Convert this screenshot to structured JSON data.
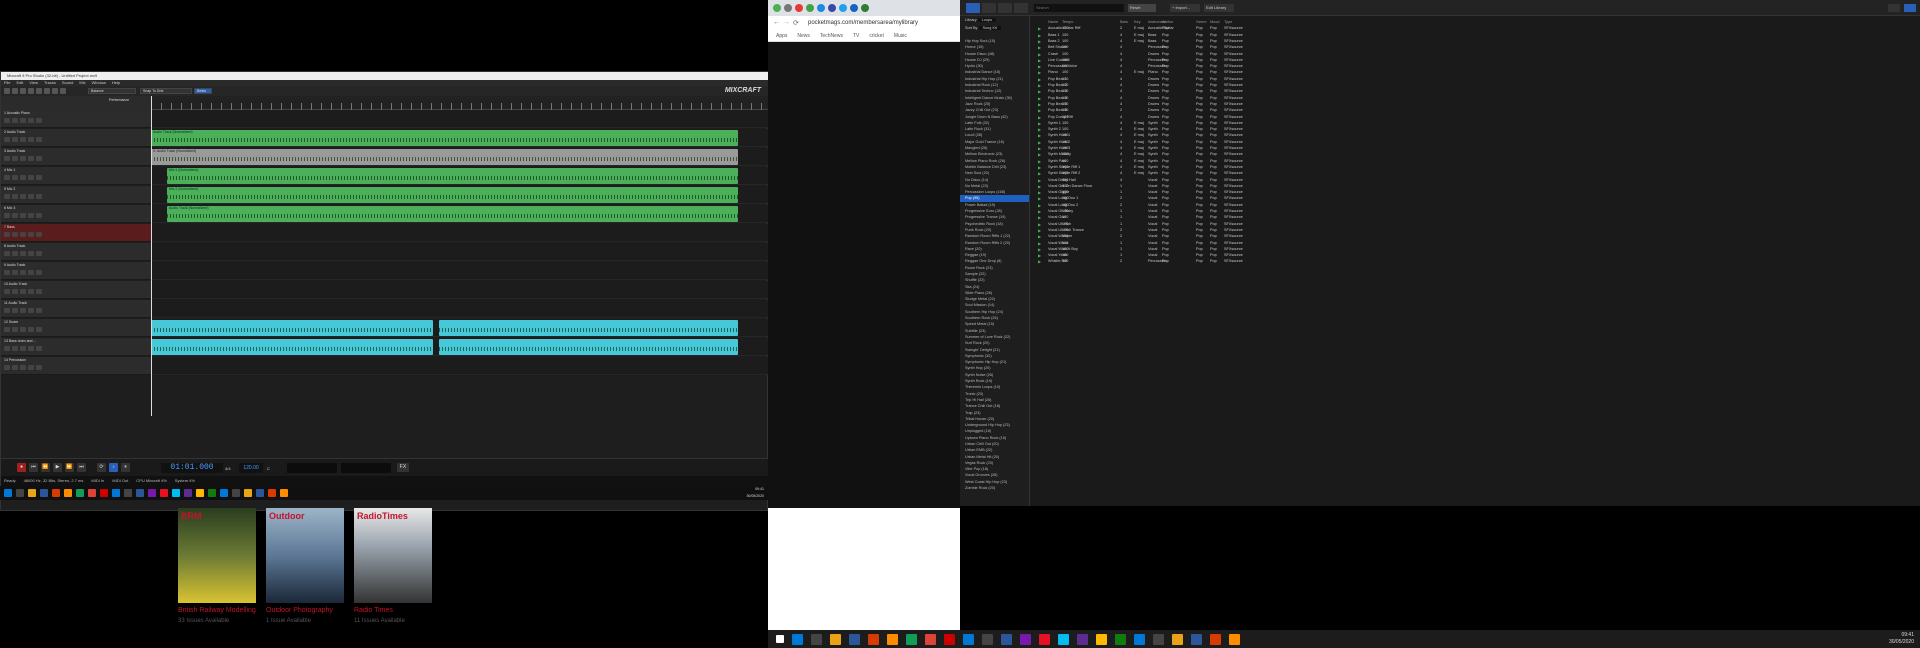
{
  "mixcraft": {
    "title": "Mixcraft 9 Pro Studio (32-bit) - Untitled Project.mx9",
    "menu": [
      "File",
      "Edit",
      "View",
      "Tracks",
      "Sound",
      "Mix",
      "Window",
      "Help"
    ],
    "logo": "MIXCRAFT",
    "toolbar_select_1": "Balance",
    "toolbar_select_2": "Snap To Grid",
    "toolbar_btn": "Beats",
    "header_label": "Performance",
    "tracks": [
      {
        "name": "1 Acoustic Piano"
      },
      {
        "name": "2 Audio Track"
      },
      {
        "name": "3 Audio Track"
      },
      {
        "name": "4 Mic 1"
      },
      {
        "name": "5 Mic 2"
      },
      {
        "name": "6 Mic 3"
      },
      {
        "name": "7 Bass"
      },
      {
        "name": "8 Audio Track"
      },
      {
        "name": "9 Audio Track"
      },
      {
        "name": "10 Audio Track"
      },
      {
        "name": "11 Audio Track"
      },
      {
        "name": "12 Snare"
      },
      {
        "name": "13 Bass drum and ..."
      },
      {
        "name": "14 Percussion"
      }
    ],
    "clips": {
      "c1": "Audio Track (Normalized)",
      "c2": "3: Audio Track (Normalized)",
      "c3": "Mic 1 (Normalized)",
      "c4": "Mic 2 (Normalized)",
      "c5": "Audio Track (Normalized)"
    },
    "transport_time": "01:01.000",
    "time_sig": "4/4",
    "bpm": "120.00",
    "key": "C",
    "fx": "FX",
    "status": [
      "Ready",
      "48000 Hz, 32 Bits, Stereo, 2.7 ms",
      "MIDI In",
      "MIDI Out",
      "CPU Mixcraft 4%",
      "System 4%"
    ],
    "clock_time": "09:41",
    "clock_date": "30/05/2020"
  },
  "browser": {
    "url": "pocketmags.com/membersarea/mylibrary",
    "bookmarks": [
      "Apps",
      "News",
      "TechNews",
      "TV",
      "cricket",
      "Music"
    ],
    "magazines": [
      {
        "cover": "BRM",
        "title": "British Railway Modelling",
        "sub": "33 Issues Available"
      },
      {
        "cover": "Outdoor",
        "title": "Outdoor Photography",
        "sub": "1 Issue Available"
      },
      {
        "cover": "RadioTimes",
        "title": "Radio Times",
        "sub": "11 Issues Available"
      }
    ],
    "clock_time": "09:41",
    "clock_date": "30/05/2020"
  },
  "library": {
    "search_placeholder": "Search",
    "reset_label": "Reset",
    "import_label": "+ Import...",
    "edit_label": "Edit Library",
    "library_label": "Library",
    "library_value": "Loops",
    "sort_label": "Sort By",
    "sort_value": "Song Kit",
    "categories": [
      "Hip Hop Soul (15)",
      "Horror (16)",
      "House Disco (48)",
      "House DJ (29)",
      "Hydro (30)",
      "Industrial Dance (16)",
      "Industrial Hip Hop (21)",
      "Industrial Rock (12)",
      "Industrial Techno (12)",
      "Intelligent Dance Music (30)",
      "Jazz Rock (25)",
      "Jazzy Chill Out (23)",
      "Jungle Drum N Bass (42)",
      "Latin Folk (32)",
      "Latin Rock (31)",
      "Loud! (28)",
      "Major Gold Trance (16)",
      "Mangled (28)",
      "Mellow Electronic (23)",
      "Mellow Piano Rock (26)",
      "Mobile Balance Drill (23)",
      "New Soul (20)",
      "Nu Disco (14)",
      "Nu Metal (23)",
      "Percussion Loops (168)",
      "Pop (95)",
      "Power Ballad (15)",
      "Progressive Euro (28)",
      "Progressive Trance (19)",
      "Psychedelic Rock (18)",
      "Punk Rock (20)",
      "Random Room Riffs 1 (22)",
      "Random Room Riffs 2 (20)",
      "Rave (20)",
      "Reggae (19)",
      "Reggae One Drop (8)",
      "Room Rock (23)",
      "Sample (22)",
      "Shuffle (22)",
      "Ska (24)",
      "Slide Piano (28)",
      "Sludge Metal (22)",
      "Soul Mission (14)",
      "Southern Hip Hop (24)",
      "Southern Rock (26)",
      "Speed Metal (15)",
      "Subtitle (23)",
      "Summer of Love Rock (22)",
      "Surf Rock (20)",
      "Swingin' Delight (21)",
      "Symphonic (32)",
      "Symphonic Hip Hop (21)",
      "Synth Hop (20)",
      "Synth Noise (26)",
      "Synth Rock (19)",
      "Theremin Loops (10)",
      "Tronic (20)",
      "Trip Hi Hall (26)",
      "Trance Chill Out (18)",
      "Trap (23)",
      "Tribal House (20)",
      "Underground Hip Hop (23)",
      "Unplugged (16)",
      "Uptown Piano Rock (15)",
      "Urban Chill Out (20)",
      "Urban EMB (22)",
      "Urban Metal Hit (20)",
      "Vegas Rock (20)",
      "Vibe Pop (18)",
      "Vocal Grooves (28)",
      "West Coast Hip Hop (23)",
      "Zombie Rock (20)"
    ],
    "selected_category": "Pop (95)",
    "columns": [
      "Name",
      "Tempo",
      "Bars",
      "Key",
      "Instrument",
      "Author",
      "Genre",
      "Mood",
      "Type"
    ],
    "rows": [
      [
        "Acoustic Guitar Riff",
        "100",
        "2",
        "E maj",
        "Acoustic Guitar",
        "Pop",
        "Pop",
        "Pop",
        "SFXsource"
      ],
      [
        "Bass 1",
        "100",
        "4",
        "E maj",
        "Bass",
        "Pop",
        "Pop",
        "Pop",
        "SFXsource"
      ],
      [
        "Bass 2",
        "100",
        "4",
        "E maj",
        "Bass",
        "Pop",
        "Pop",
        "Pop",
        "SFXsource"
      ],
      [
        "Bell Shaker",
        "100",
        "4",
        "",
        "Percussion",
        "Pop",
        "Pop",
        "Pop",
        "SFXsource"
      ],
      [
        "Crash",
        "100",
        "4",
        "",
        "Drums",
        "Pop",
        "Pop",
        "Pop",
        "SFXsource"
      ],
      [
        "Live Cowbell",
        "100",
        "4",
        "",
        "Percussion",
        "Pop",
        "Pop",
        "Pop",
        "SFXsource"
      ],
      [
        "Percussion Voice",
        "100",
        "4",
        "",
        "Percussion",
        "Pop",
        "Pop",
        "Pop",
        "SFXsource"
      ],
      [
        "Piano",
        "100",
        "4",
        "E maj",
        "Piano",
        "Pop",
        "Pop",
        "Pop",
        "SFXsource"
      ],
      [
        "Pop Beat 1",
        "100",
        "4",
        "",
        "Drums",
        "Pop",
        "Pop",
        "Pop",
        "SFXsource"
      ],
      [
        "Pop Beat 2",
        "100",
        "4",
        "",
        "Drums",
        "Pop",
        "Pop",
        "Pop",
        "SFXsource"
      ],
      [
        "Pop Beat 3",
        "100",
        "4",
        "",
        "Drums",
        "Pop",
        "Pop",
        "Pop",
        "SFXsource"
      ],
      [
        "Pop Beat 4",
        "100",
        "4",
        "",
        "Drums",
        "Pop",
        "Pop",
        "Pop",
        "SFXsource"
      ],
      [
        "Pop Beat 5",
        "100",
        "4",
        "",
        "Drums",
        "Pop",
        "Pop",
        "Pop",
        "SFXsource"
      ],
      [
        "Pop Beat 6",
        "100",
        "2",
        "",
        "Drums",
        "Pop",
        "Pop",
        "Pop",
        "SFXsource"
      ],
      [
        "Pop Comp Riff",
        "100",
        "4",
        "",
        "Drums",
        "Pop",
        "Pop",
        "Pop",
        "SFXsource"
      ],
      [
        "Synth 1",
        "100",
        "4",
        "E maj",
        "Synth",
        "Pop",
        "Pop",
        "Pop",
        "SFXsource"
      ],
      [
        "Synth 2",
        "100",
        "4",
        "E maj",
        "Synth",
        "Pop",
        "Pop",
        "Pop",
        "SFXsource"
      ],
      [
        "Synth Horn 1",
        "100",
        "4",
        "E maj",
        "Synth",
        "Pop",
        "Pop",
        "Pop",
        "SFXsource"
      ],
      [
        "Synth Horn 2",
        "100",
        "4",
        "E maj",
        "Synth",
        "Pop",
        "Pop",
        "Pop",
        "SFXsource"
      ],
      [
        "Synth Horn 3",
        "100",
        "4",
        "E maj",
        "Synth",
        "Pop",
        "Pop",
        "Pop",
        "SFXsource"
      ],
      [
        "Synth Melody",
        "100",
        "4",
        "E maj",
        "Synth",
        "Pop",
        "Pop",
        "Pop",
        "SFXsource"
      ],
      [
        "Synth Pad",
        "100",
        "4",
        "E maj",
        "Synth",
        "Pop",
        "Pop",
        "Pop",
        "SFXsource"
      ],
      [
        "Synth Simple Riff 1",
        "100",
        "4",
        "E maj",
        "Synth",
        "Pop",
        "Pop",
        "Pop",
        "SFXsource"
      ],
      [
        "Synth Simple Riff 2",
        "100",
        "4",
        "E maj",
        "Synth",
        "Pop",
        "Pop",
        "Pop",
        "SFXsource"
      ],
      [
        "Vocal Delay Hall",
        "100",
        "4",
        "",
        "Vocal",
        "Pop",
        "Pop",
        "Pop",
        "SFXsource"
      ],
      [
        "Vocal Get On Dance Floor",
        "100",
        "1",
        "",
        "Vocal",
        "Pop",
        "Pop",
        "Pop",
        "SFXsource"
      ],
      [
        "Vocal Giggle",
        "100",
        "1",
        "",
        "Vocal",
        "Pop",
        "Pop",
        "Pop",
        "SFXsource"
      ],
      [
        "Vocal Long Ooo 1",
        "100",
        "2",
        "",
        "Vocal",
        "Pop",
        "Pop",
        "Pop",
        "SFXsource"
      ],
      [
        "Vocal Long Ooo 2",
        "100",
        "2",
        "",
        "Vocal",
        "Pop",
        "Pop",
        "Pop",
        "SFXsource"
      ],
      [
        "Vocal Oh Baby",
        "100",
        "1",
        "",
        "Vocal",
        "Pop",
        "Pop",
        "Pop",
        "SFXsource"
      ],
      [
        "Vocal Ooo",
        "100",
        "1",
        "",
        "Vocal",
        "Pop",
        "Pop",
        "Pop",
        "SFXsource"
      ],
      [
        "Vocal Uh Huh",
        "100",
        "1",
        "",
        "Vocal",
        "Pop",
        "Pop",
        "Pop",
        "SFXsource"
      ],
      [
        "Vocal Uh Huh Trance",
        "100",
        "2",
        "",
        "Vocal",
        "Pop",
        "Pop",
        "Pop",
        "SFXsource"
      ],
      [
        "Vocal Whisper",
        "100",
        "2",
        "",
        "Vocal",
        "Pop",
        "Pop",
        "Pop",
        "SFXsource"
      ],
      [
        "Vocal Whoa",
        "100",
        "1",
        "",
        "Vocal",
        "Pop",
        "Pop",
        "Pop",
        "SFXsource"
      ],
      [
        "Vocal Work It Boy",
        "100",
        "1",
        "",
        "Vocal",
        "Pop",
        "Pop",
        "Pop",
        "SFXsource"
      ],
      [
        "Vocal Yeah",
        "100",
        "1",
        "",
        "Vocal",
        "Pop",
        "Pop",
        "Pop",
        "SFXsource"
      ],
      [
        "Whistle Riff",
        "100",
        "2",
        "",
        "Percussion",
        "Pop",
        "Pop",
        "Pop",
        "SFXsource"
      ]
    ]
  }
}
